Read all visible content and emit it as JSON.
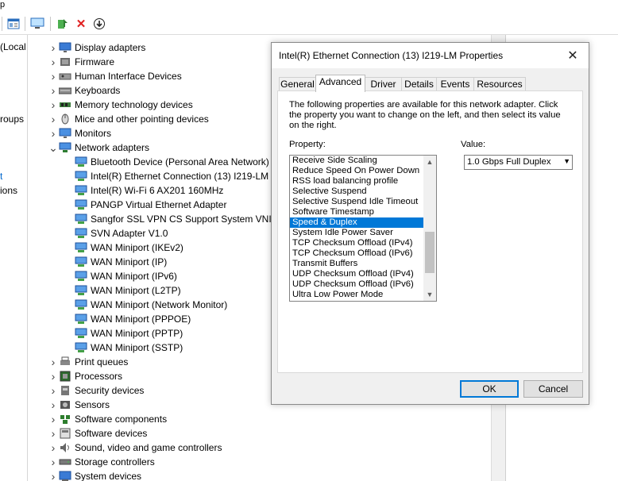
{
  "colors": {
    "selection": "#0078d7",
    "panel_bg": "#f0f0f0"
  },
  "toolbar": {
    "icons": [
      "properties-icon",
      "computer-icon",
      "update-driver-icon",
      "uninstall-icon",
      "download-icon"
    ]
  },
  "left_pane": {
    "items": [
      "(Local",
      "roups",
      "t",
      "ions"
    ]
  },
  "tree": {
    "items": [
      {
        "label": "Display adapters",
        "icon": "display-icon",
        "level": 0,
        "expander": "collapsed"
      },
      {
        "label": "Firmware",
        "icon": "firmware-icon",
        "level": 0,
        "expander": "collapsed"
      },
      {
        "label": "Human Interface Devices",
        "icon": "hid-icon",
        "level": 0,
        "expander": "collapsed"
      },
      {
        "label": "Keyboards",
        "icon": "keyboard-icon",
        "level": 0,
        "expander": "collapsed"
      },
      {
        "label": "Memory technology devices",
        "icon": "memory-icon",
        "level": 0,
        "expander": "collapsed"
      },
      {
        "label": "Mice and other pointing devices",
        "icon": "mouse-icon",
        "level": 0,
        "expander": "collapsed"
      },
      {
        "label": "Monitors",
        "icon": "monitor-icon",
        "level": 0,
        "expander": "collapsed"
      },
      {
        "label": "Network adapters",
        "icon": "network-icon",
        "level": 0,
        "expander": "expanded"
      },
      {
        "label": "Bluetooth Device (Personal Area Network)",
        "icon": "network-adapter-icon",
        "level": 1
      },
      {
        "label": "Intel(R) Ethernet Connection (13) I219-LM",
        "icon": "network-adapter-icon",
        "level": 1
      },
      {
        "label": "Intel(R) Wi-Fi 6 AX201 160MHz",
        "icon": "network-adapter-icon",
        "level": 1
      },
      {
        "label": "PANGP Virtual Ethernet Adapter",
        "icon": "network-adapter-icon",
        "level": 1
      },
      {
        "label": "Sangfor SSL VPN CS Support System VNIC",
        "icon": "network-adapter-icon",
        "level": 1
      },
      {
        "label": "SVN Adapter V1.0",
        "icon": "network-adapter-icon",
        "level": 1
      },
      {
        "label": "WAN Miniport (IKEv2)",
        "icon": "network-adapter-icon",
        "level": 1
      },
      {
        "label": "WAN Miniport (IP)",
        "icon": "network-adapter-icon",
        "level": 1
      },
      {
        "label": "WAN Miniport (IPv6)",
        "icon": "network-adapter-icon",
        "level": 1
      },
      {
        "label": "WAN Miniport (L2TP)",
        "icon": "network-adapter-icon",
        "level": 1
      },
      {
        "label": "WAN Miniport (Network Monitor)",
        "icon": "network-adapter-icon",
        "level": 1
      },
      {
        "label": "WAN Miniport (PPPOE)",
        "icon": "network-adapter-icon",
        "level": 1
      },
      {
        "label": "WAN Miniport (PPTP)",
        "icon": "network-adapter-icon",
        "level": 1
      },
      {
        "label": "WAN Miniport (SSTP)",
        "icon": "network-adapter-icon",
        "level": 1
      },
      {
        "label": "Print queues",
        "icon": "printer-icon",
        "level": 0,
        "expander": "collapsed"
      },
      {
        "label": "Processors",
        "icon": "processor-icon",
        "level": 0,
        "expander": "collapsed"
      },
      {
        "label": "Security devices",
        "icon": "security-icon",
        "level": 0,
        "expander": "collapsed"
      },
      {
        "label": "Sensors",
        "icon": "sensor-icon",
        "level": 0,
        "expander": "collapsed"
      },
      {
        "label": "Software components",
        "icon": "software-component-icon",
        "level": 0,
        "expander": "collapsed"
      },
      {
        "label": "Software devices",
        "icon": "software-device-icon",
        "level": 0,
        "expander": "collapsed"
      },
      {
        "label": "Sound, video and game controllers",
        "icon": "sound-icon",
        "level": 0,
        "expander": "collapsed"
      },
      {
        "label": "Storage controllers",
        "icon": "storage-icon",
        "level": 0,
        "expander": "collapsed"
      },
      {
        "label": "System devices",
        "icon": "system-icon",
        "level": 0,
        "expander": "collapsed"
      }
    ]
  },
  "dialog": {
    "title": "Intel(R) Ethernet Connection (13) I219-LM Properties",
    "tabs": [
      "General",
      "Advanced",
      "Driver",
      "Details",
      "Events",
      "Resources"
    ],
    "active_tab": "Advanced",
    "description": "The following properties are available for this network adapter. Click the property you want to change on the left, and then select its value on the right.",
    "property_label": "Property:",
    "value_label": "Value:",
    "properties": [
      "Receive Side Scaling",
      "Reduce Speed On Power Down",
      "RSS load balancing profile",
      "Selective Suspend",
      "Selective Suspend Idle Timeout",
      "Software Timestamp",
      "Speed & Duplex",
      "System Idle Power Saver",
      "TCP Checksum Offload (IPv4)",
      "TCP Checksum Offload (IPv6)",
      "Transmit Buffers",
      "UDP Checksum Offload (IPv4)",
      "UDP Checksum Offload (IPv6)",
      "Ultra Low Power Mode"
    ],
    "selected_property": "Speed & Duplex",
    "value": "1.0 Gbps Full Duplex",
    "ok_label": "OK",
    "cancel_label": "Cancel"
  }
}
